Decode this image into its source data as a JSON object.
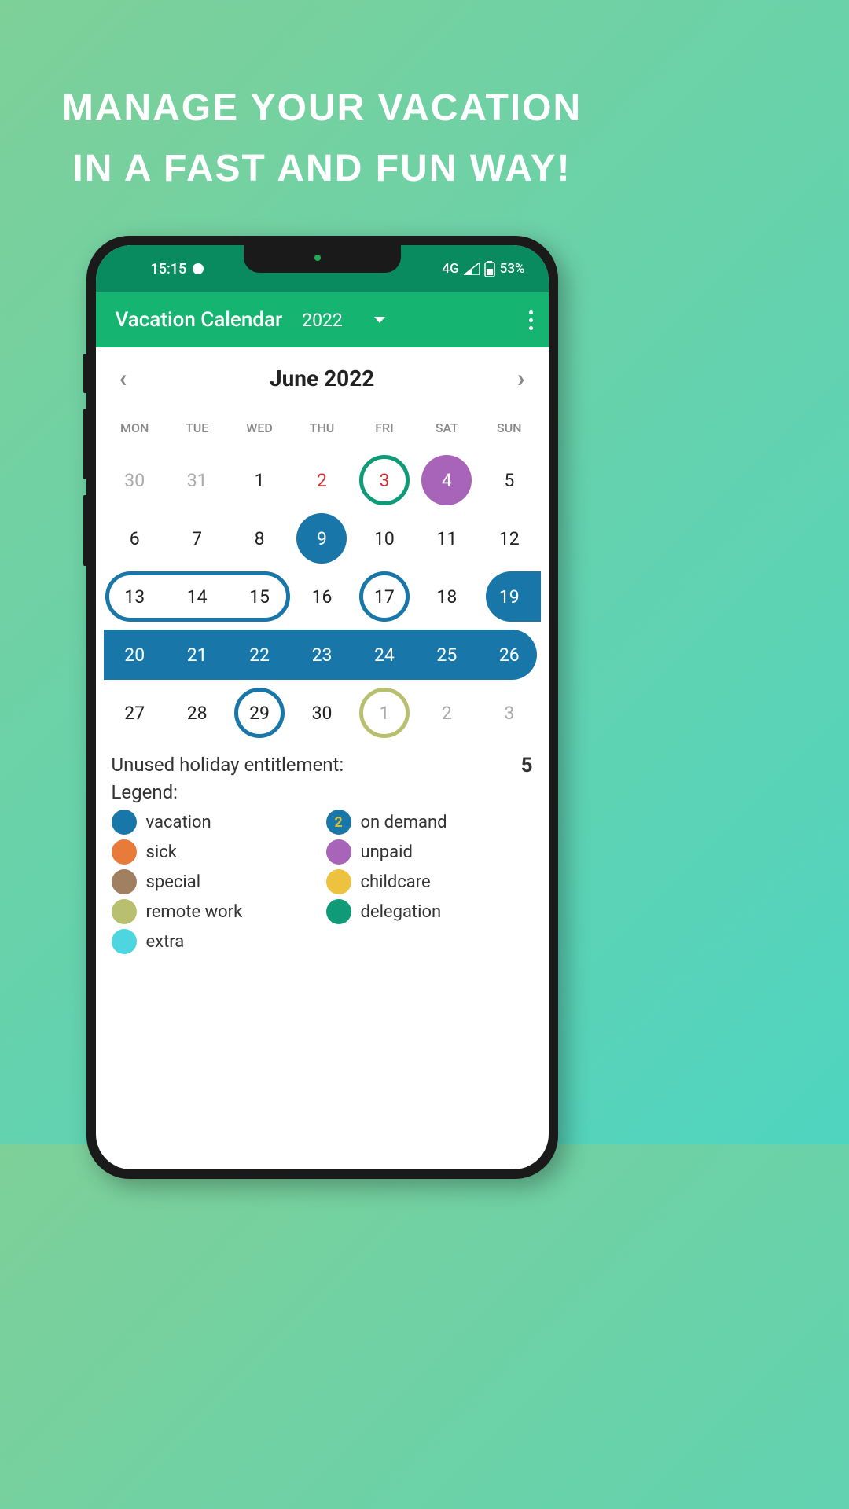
{
  "tagline": {
    "line1": "MANAGE YOUR VACATION",
    "line2": "IN A FAST AND FUN WAY!"
  },
  "statusBar": {
    "time": "15:15",
    "network": "4G",
    "battery": "53%"
  },
  "header": {
    "appTitle": "Vacation Calendar",
    "year": "2022"
  },
  "monthNav": {
    "title": "June 2022"
  },
  "weekdays": [
    "MON",
    "TUE",
    "WED",
    "THU",
    "FRI",
    "SAT",
    "SUN"
  ],
  "weeks": [
    [
      "30",
      "31",
      "1",
      "2",
      "3",
      "4",
      "5"
    ],
    [
      "6",
      "7",
      "8",
      "9",
      "10",
      "11",
      "12"
    ],
    [
      "13",
      "14",
      "15",
      "16",
      "17",
      "18",
      "19"
    ],
    [
      "20",
      "21",
      "22",
      "23",
      "24",
      "25",
      "26"
    ],
    [
      "27",
      "28",
      "29",
      "30",
      "1",
      "2",
      "3"
    ]
  ],
  "summary": {
    "unusedLabel": "Unused holiday entitlement:",
    "unusedValue": "5",
    "legendLabel": "Legend:"
  },
  "legend": {
    "vacation": "vacation",
    "onDemand": "on demand",
    "onDemandNum": "2",
    "sick": "sick",
    "unpaid": "unpaid",
    "special": "special",
    "childcare": "childcare",
    "remote": "remote work",
    "delegation": "delegation",
    "extra": "extra"
  },
  "colors": {
    "vacation": "#1976a8",
    "sick": "#e87b3a",
    "unpaid": "#a864b8",
    "special": "#a08060",
    "childcare": "#ecc23f",
    "remote": "#b8c070",
    "delegation": "#0f9b78",
    "extra": "#4dd5e0",
    "onDemandText": "#d4c040"
  }
}
